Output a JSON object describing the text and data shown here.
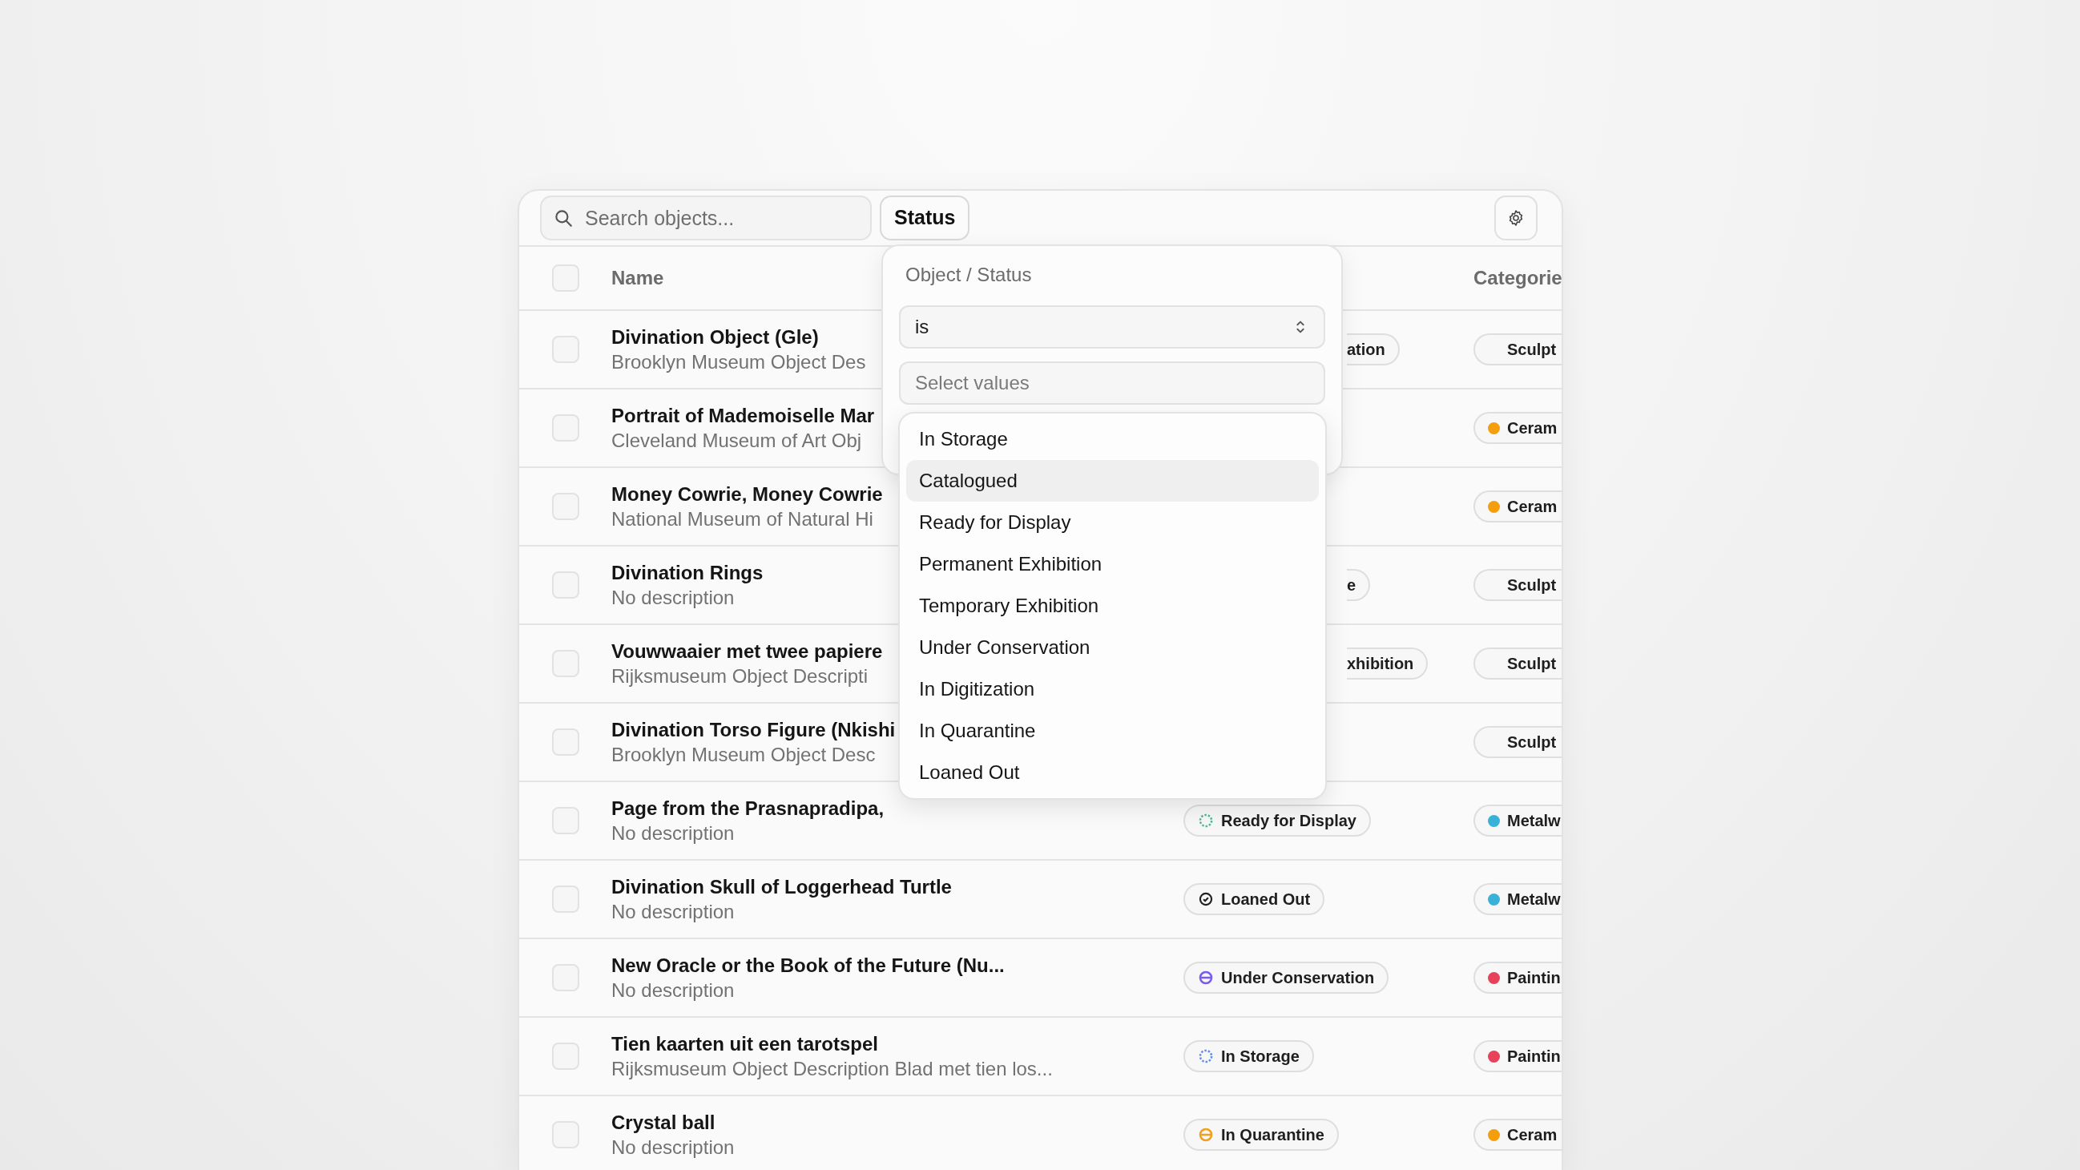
{
  "toolbar": {
    "search": {
      "placeholder": "Search objects..."
    },
    "filter_button": "Status"
  },
  "table": {
    "columns": [
      {
        "label": "Name"
      },
      {
        "label": "Categorie"
      }
    ],
    "header_checked": false,
    "rows": [
      {
        "checked": false,
        "name": "Divination Object (Gle)",
        "description": "Brooklyn Museum Object Des",
        "status": {
          "text": "ation",
          "kind": "fragment"
        },
        "category": {
          "text": "Sculpt"
        }
      },
      {
        "checked": false,
        "name": "Portrait of Mademoiselle Mar",
        "description": "Cleveland Museum of Art Obj",
        "category": {
          "text": "Ceram",
          "color": "#f59e0b"
        }
      },
      {
        "checked": false,
        "name": "Money Cowrie, Money Cowrie",
        "description": "National Museum of Natural Hi",
        "category": {
          "text": "Ceram",
          "color": "#f59e0b"
        }
      },
      {
        "checked": false,
        "name": "Divination Rings",
        "description": "No description",
        "status": {
          "text": "e",
          "kind": "fragment"
        },
        "category": {
          "text": "Sculpt"
        }
      },
      {
        "checked": false,
        "name": "Vouwwaaier met twee papiere",
        "description": "Rijksmuseum Object Descripti",
        "status": {
          "text": "xhibition",
          "kind": "fragment"
        },
        "category": {
          "text": "Sculpt"
        }
      },
      {
        "checked": false,
        "name": "Divination Torso Figure (Nkishi",
        "description": "Brooklyn Museum Object Desc",
        "category": {
          "text": "Sculpt"
        }
      },
      {
        "checked": false,
        "name": "Page from the Prasnapradipa,",
        "description": "No description",
        "status": {
          "text": "Ready for Display",
          "kind": "dotted",
          "color": "#4fb89a"
        },
        "category": {
          "text": "Metalw",
          "color": "#38b2d8"
        }
      },
      {
        "checked": false,
        "name": "Divination Skull of Loggerhead Turtle",
        "description": "No description",
        "status": {
          "text": "Loaned Out",
          "kind": "check",
          "color": "#222222"
        },
        "category": {
          "text": "Metalw",
          "color": "#38b2d8"
        }
      },
      {
        "checked": false,
        "name": "New Oracle or the Book of the Future (Nu...",
        "description": "No description",
        "status": {
          "text": "Under Conservation",
          "kind": "minus",
          "color": "#7c5cf0"
        },
        "category": {
          "text": "Paintin",
          "color": "#e8415a"
        }
      },
      {
        "checked": false,
        "name": "Tien kaarten uit een tarotspel",
        "description": "Rijksmuseum Object Description Blad met tien los...",
        "status": {
          "text": "In Storage",
          "kind": "dotted",
          "color": "#5b8def"
        },
        "category": {
          "text": "Paintin",
          "color": "#e8415a"
        }
      },
      {
        "checked": false,
        "name": "Crystal ball",
        "description": "No description",
        "status": {
          "text": "In Quarantine",
          "kind": "minus",
          "color": "#f0a020"
        },
        "category": {
          "text": "Ceram",
          "color": "#f59e0b"
        }
      }
    ]
  },
  "filter_panel": {
    "title": "Object / Status",
    "operator": "is",
    "values": {
      "placeholder": "Select values"
    },
    "options": [
      {
        "label": "In Storage",
        "highlighted": false
      },
      {
        "label": "Catalogued",
        "highlighted": true
      },
      {
        "label": "Ready for Display",
        "highlighted": false
      },
      {
        "label": "Permanent Exhibition",
        "highlighted": false
      },
      {
        "label": "Temporary Exhibition",
        "highlighted": false
      },
      {
        "label": "Under Conservation",
        "highlighted": false
      },
      {
        "label": "In Digitization",
        "highlighted": false
      },
      {
        "label": "In Quarantine",
        "highlighted": false
      },
      {
        "label": "Loaned Out",
        "highlighted": false
      }
    ]
  }
}
